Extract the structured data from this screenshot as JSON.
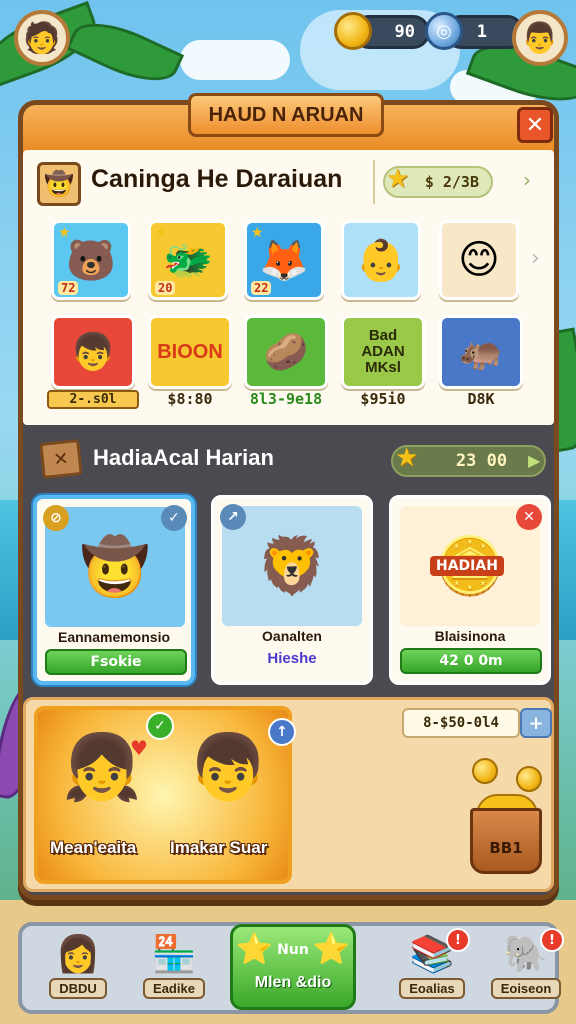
{
  "colors": {
    "accent": "#e98a24",
    "panel": "#4a4a50",
    "success": "#36a52a",
    "danger": "#e83a2a",
    "selected": "#5ab8f0"
  },
  "topbar": {
    "left_avatar_icon": "player-avatar",
    "coins": "90",
    "gems": "1",
    "right_avatar_icon": "friend-avatar"
  },
  "panel": {
    "title": "HAUD N ARUAN",
    "close_label": "✕"
  },
  "collection": {
    "title": "Caninga He Daraiuan",
    "score": "$ 2/3B",
    "row1": [
      {
        "icon": "bear-icon",
        "emoji": "🐻",
        "badge": "72",
        "bg": "#5ac8f0"
      },
      {
        "icon": "blue-beast-icon",
        "emoji": "🐲",
        "badge": "20",
        "bg": "#f8c830"
      },
      {
        "icon": "fox-icon",
        "emoji": "🦊",
        "badge": "22",
        "bg": "#3aa8e8"
      },
      {
        "icon": "baby-icon",
        "emoji": "👶",
        "badge": "",
        "bg": "#aee0f8"
      },
      {
        "icon": "smiley-icon",
        "emoji": "😊",
        "badge": "",
        "bg": "#f8e8c8"
      }
    ],
    "row2": [
      {
        "icon": "boy-icon",
        "emoji": "👦",
        "label": "2-.s0l",
        "bg": "#e8483a",
        "text": ""
      },
      {
        "icon": "bloon-icon",
        "emoji": "",
        "label": "$8:80",
        "bg": "#f8c830",
        "text": "BIOON"
      },
      {
        "icon": "seed-icon",
        "emoji": "🥔",
        "label": "8l3-9e18",
        "bg": "#5ab83a",
        "text": ""
      },
      {
        "icon": "badge-sign-icon",
        "emoji": "",
        "label": "$95i0",
        "bg": "#9ac848",
        "text": "Bad ADAN MKsl"
      },
      {
        "icon": "hippo-icon",
        "emoji": "🦛",
        "label": "D8K",
        "bg": "#4a78c8",
        "text": ""
      }
    ]
  },
  "daily": {
    "title": "HadiaAcal Harian",
    "score": "23 00",
    "cards": [
      {
        "name": "Eannamemonsio",
        "action": "Fsokie",
        "emoji": "🤠",
        "bg": "#7ac8f0",
        "corner": "⊘"
      },
      {
        "name": "Oanalten",
        "action": "Hieshe",
        "emoji": "🦁",
        "bg": "#b8dcf0",
        "corner": "↗"
      },
      {
        "name": "Blaisinona",
        "action": "42 0 0m",
        "emoji": "🪙",
        "bg": "#fff0d8",
        "corner": "✕",
        "coin_text": "HADIAH"
      }
    ]
  },
  "promo": {
    "left_label": "Mean'eaita",
    "right_label": "Imakar Suar",
    "balance": "8-$50-0l4",
    "plus_label": "+",
    "bucket_label": "BB1"
  },
  "nav": [
    {
      "label": "DBDU",
      "icon": "villager-icon",
      "emoji": "👩",
      "badge": ""
    },
    {
      "label": "Eadike",
      "icon": "shop-stall-icon",
      "emoji": "🏪",
      "badge": ""
    },
    {
      "label": "Mlen &dio",
      "top": "Nun",
      "icon": "star-icon",
      "emoji": "⭐",
      "badge": ""
    },
    {
      "label": "Eoalias",
      "icon": "books-icon",
      "emoji": "📚",
      "badge": "!"
    },
    {
      "label": "Eoiseon",
      "icon": "elephant-icon",
      "emoji": "🐘",
      "badge": "!"
    }
  ]
}
